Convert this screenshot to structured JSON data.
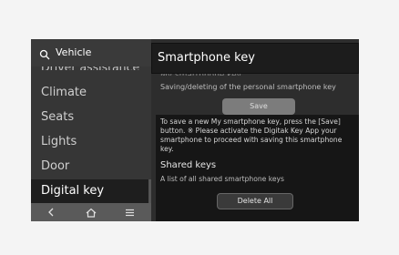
{
  "sidebar": {
    "title": "Vehicle",
    "partial_item": "Driver assistance",
    "items": [
      "Climate",
      "Seats",
      "Lights",
      "Door",
      "Digital key"
    ]
  },
  "panel": {
    "title": "Smartphone key",
    "ghost_text": "My smartphone key",
    "subtitle": "Saving/deleting of the personal smartphone key",
    "save_label": "Save",
    "info_text": "To save a new My smartphone key, press the [Save] button. ※ Please activate the Digitak Key App your smartphone to proceed with saving this smartphone key.",
    "shared_title": "Shared keys",
    "shared_subtitle": "A list of all shared smartphone keys",
    "delete_all_label": "Delete All"
  },
  "icons": {
    "search": "search-icon",
    "back": "back-icon",
    "home": "home-icon",
    "menu": "menu-icon"
  }
}
